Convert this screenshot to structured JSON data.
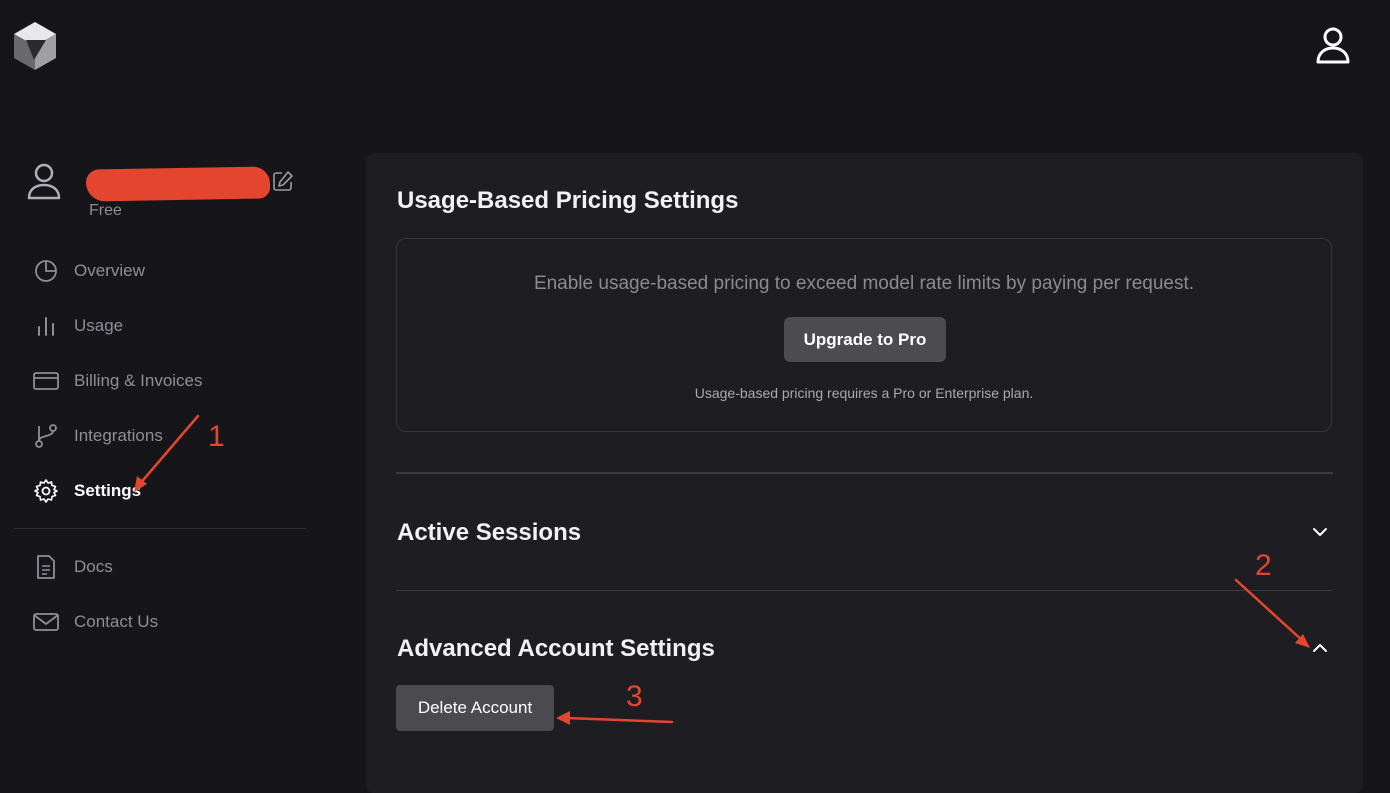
{
  "header": {
    "logo_icon": "cube-logo-icon",
    "account_icon": "user-account-icon"
  },
  "profile": {
    "plan": "Free",
    "avatar_icon": "user-avatar-icon",
    "edit_icon": "edit-icon"
  },
  "sidebar": {
    "items": [
      {
        "label": "Overview",
        "icon": "pie-chart-icon",
        "active": false
      },
      {
        "label": "Usage",
        "icon": "bar-chart-icon",
        "active": false
      },
      {
        "label": "Billing & Invoices",
        "icon": "credit-card-icon",
        "active": false
      },
      {
        "label": "Integrations",
        "icon": "git-branch-icon",
        "active": false
      },
      {
        "label": "Settings",
        "icon": "gear-icon",
        "active": true
      }
    ],
    "secondary": [
      {
        "label": "Docs",
        "icon": "document-icon"
      },
      {
        "label": "Contact Us",
        "icon": "mail-icon"
      }
    ]
  },
  "main": {
    "usage_pricing": {
      "title": "Usage-Based Pricing Settings",
      "message": "Enable usage-based pricing to exceed model rate limits by paying per request.",
      "button": "Upgrade to Pro",
      "note": "Usage-based pricing requires a Pro or Enterprise plan."
    },
    "active_sessions": {
      "title": "Active Sessions",
      "expanded": false
    },
    "advanced": {
      "title": "Advanced Account Settings",
      "expanded": true,
      "delete_button": "Delete Account"
    }
  },
  "annotations": {
    "step1": "1",
    "step2": "2",
    "step3": "3",
    "color": "#e4452f"
  },
  "colors": {
    "background": "#16161a",
    "panel": "#1e1e22",
    "button": "#4b4b50",
    "muted_text": "#8e8e94"
  }
}
